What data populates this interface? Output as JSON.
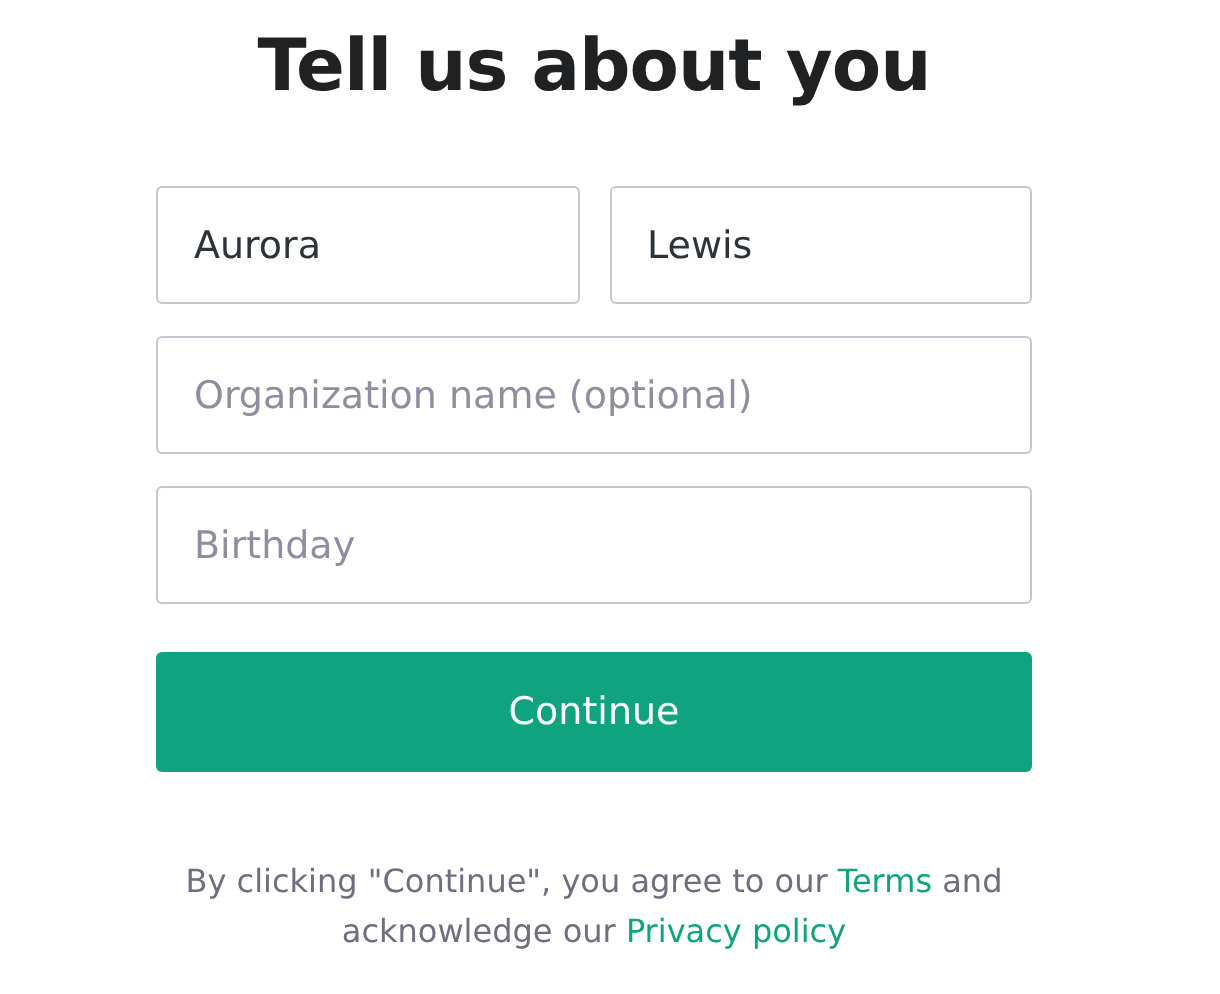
{
  "title": "Tell us about you",
  "name_fields": [
    {
      "value": "Aurora"
    },
    {
      "value": "Lewis"
    }
  ],
  "fields": [
    {
      "placeholder": "Organization name (optional)"
    },
    {
      "placeholder": "Birthday"
    }
  ],
  "button": "Continue",
  "legal": [
    {
      "kind": "text",
      "text": "By clicking \"Continue\", you agree to our "
    },
    {
      "kind": "link",
      "text": "Terms"
    },
    {
      "kind": "text",
      "text": " and acknowledge our "
    },
    {
      "kind": "link",
      "text": "Privacy policy"
    }
  ]
}
